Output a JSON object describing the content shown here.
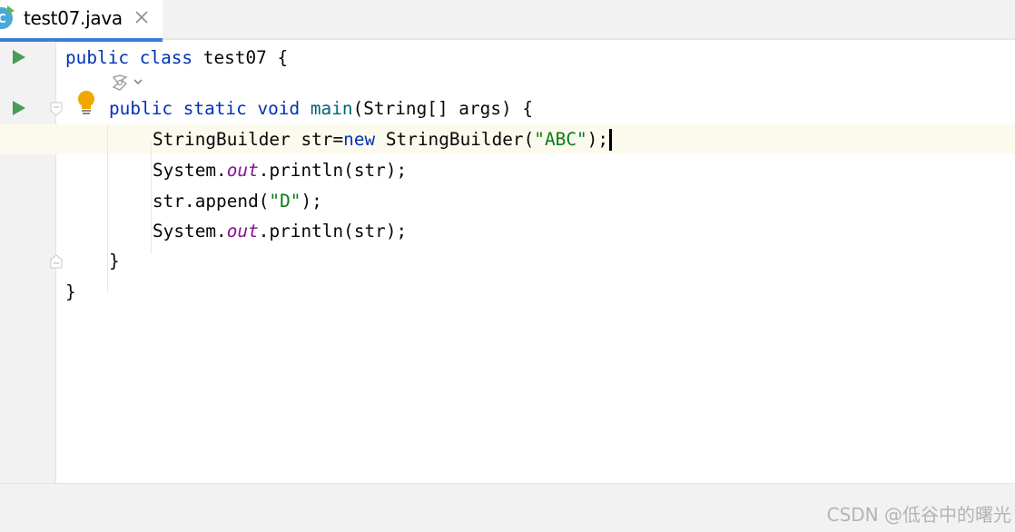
{
  "tab": {
    "file_name": "test07.java",
    "file_icon": "java-class-icon",
    "close_icon": "close-icon",
    "accent_color": "#3b7ed8"
  },
  "code": {
    "line1": {
      "kw1": "public",
      "kw2": "class",
      "name": " test07 {"
    },
    "line2": {
      "kw1": "public",
      "kw2": "static",
      "kw3": "void",
      "method": "main",
      "rest": "(String[] args) {"
    },
    "line3": {
      "a": "StringBuilder str=",
      "kw": "new",
      "b": " StringBuilder(",
      "str": "\"ABC\"",
      "c": ");"
    },
    "line4": {
      "a": "System.",
      "field": "out",
      "b": ".println(str);"
    },
    "line5": {
      "a": "str.append(",
      "str": "\"D\"",
      "b": ");"
    },
    "line6": {
      "a": "System.",
      "field": "out",
      "b": ".println(str);"
    },
    "line7": "}",
    "line8": "}"
  },
  "colors": {
    "keyword": "#0033b3",
    "method": "#00627a",
    "string": "#067d17",
    "field": "#871094",
    "current_line": "#fcfaed"
  },
  "icons": {
    "run": "run-icon",
    "fold": "fold-icon",
    "bulb": "lightbulb-icon",
    "lens": "code-vision-icon"
  },
  "watermark": "CSDN @低谷中的曙光"
}
